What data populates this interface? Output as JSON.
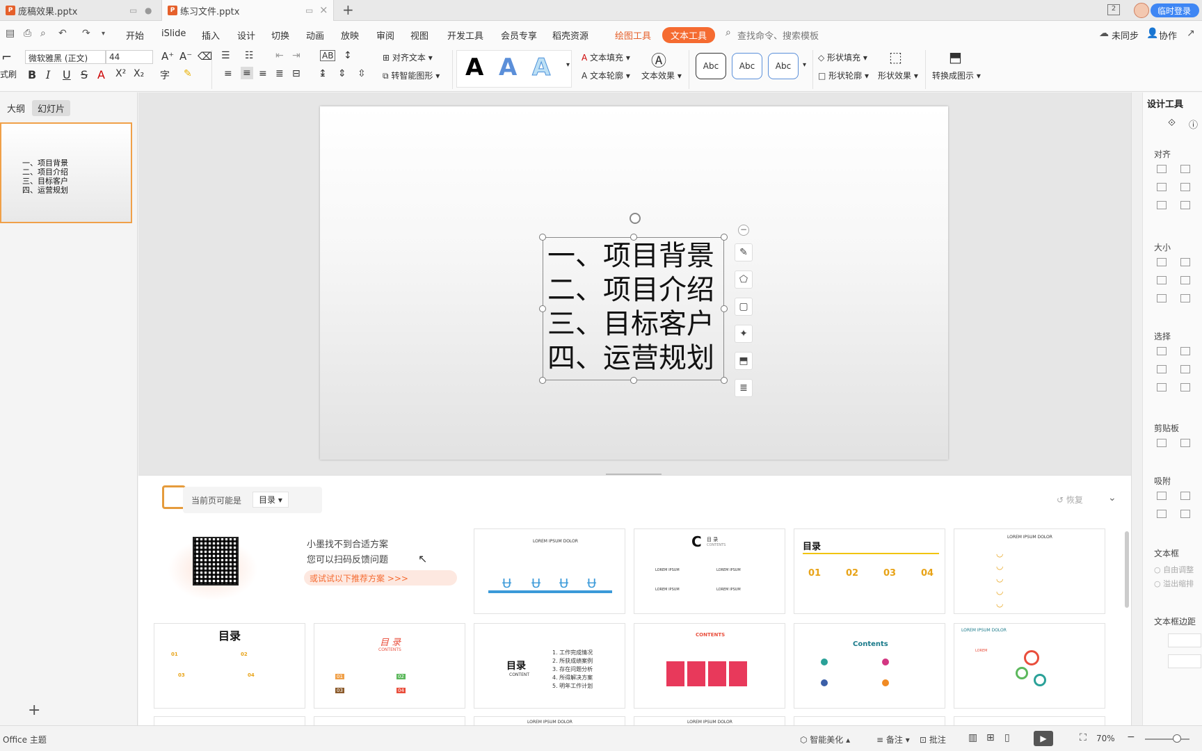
{
  "tabs": [
    {
      "label": "庞稿效果.pptx"
    },
    {
      "label": "练习文件.pptx"
    }
  ],
  "tab_count_badge": "2",
  "login_button": "临时登录",
  "menu": {
    "items": [
      "开始",
      "iSlide",
      "插入",
      "设计",
      "切换",
      "动画",
      "放映",
      "审阅",
      "视图",
      "开发工具",
      "会员专享",
      "稻壳资源"
    ],
    "drawing_tools": "绘图工具",
    "text_tools": "文本工具",
    "search_placeholder": "查找命令、搜索模板",
    "sync": "未同步",
    "collab": "协作"
  },
  "ribbon": {
    "format_painter": "式刷",
    "font_name": "微软雅黑 (正文)",
    "font_size": "44",
    "align_text": "对齐文本",
    "smart_art": "转智能图形",
    "text_fill": "文本填充",
    "text_outline": "文本轮廓",
    "text_effect": "文本效果",
    "abc": [
      "Abc",
      "Abc",
      "Abc"
    ],
    "shape_fill": "形状填充",
    "shape_outline": "形状轮廓",
    "shape_effect": "形状效果",
    "convert_to_image": "转换成图示"
  },
  "left_panel": {
    "tab_outline": "大纲",
    "tab_slides": "幻灯片",
    "thumbnail_lines": [
      "一、项目背景",
      "二、项目介绍",
      "三、目标客户",
      "四、运营规划"
    ],
    "add_slide": "+"
  },
  "slide": {
    "lines": [
      "一、项目背景",
      "二、项目介绍",
      "三、目标客户",
      "四、运营规划"
    ]
  },
  "suggestions": {
    "current_page": "当前页可能是",
    "page_type": "目录",
    "restore": "恢复",
    "feedback_line1": "小墨找不到合适方案",
    "feedback_line2": "您可以扫码反馈问题",
    "try_recommend": "或试试以下推荐方案 >>>",
    "cards": {
      "c1_title": "LOREM IPSUM DOLOR",
      "c2_title": "目 录",
      "c2_sub": "CONTENTS",
      "c3_title": "目录",
      "c3_nums": [
        "01",
        "02",
        "03",
        "04"
      ],
      "c4_title": "LOREM IPSUM DOLOR",
      "c5_title": "目录",
      "c6_title": "目 录",
      "c6_sub": "CONTENTS",
      "c7_title": "目录",
      "c7_sub": "CONTENT",
      "c7_items": [
        "1. 工作完成情况",
        "2. 所获成绩案例",
        "3. 存在问题分析",
        "4. 所得解决方案",
        "5. 明年工作计划"
      ],
      "c8_title": "CONTENTS",
      "c9_title": "Contents",
      "c10_title": "LOREM IPSUM DOLOR",
      "c10_label": "LOREM",
      "lorem": "LOREM IPSUM",
      "lorem_dolor": "LOREM IPSUM DOLOR"
    }
  },
  "right_panel": {
    "title": "设计工具",
    "sections": [
      "对齐",
      "大小",
      "选择",
      "剪贴板",
      "吸附",
      "文本框",
      "文本框边距"
    ],
    "autofit": "自由调整",
    "overflow": "溢出缩排"
  },
  "status": {
    "theme": "Office 主题",
    "beautify": "智能美化",
    "notes": "备注",
    "comments": "批注",
    "zoom": "70%"
  },
  "colors": {
    "accent_orange": "#f56b31",
    "selection_border": "#f0a048",
    "login_blue": "#3e86f4"
  }
}
